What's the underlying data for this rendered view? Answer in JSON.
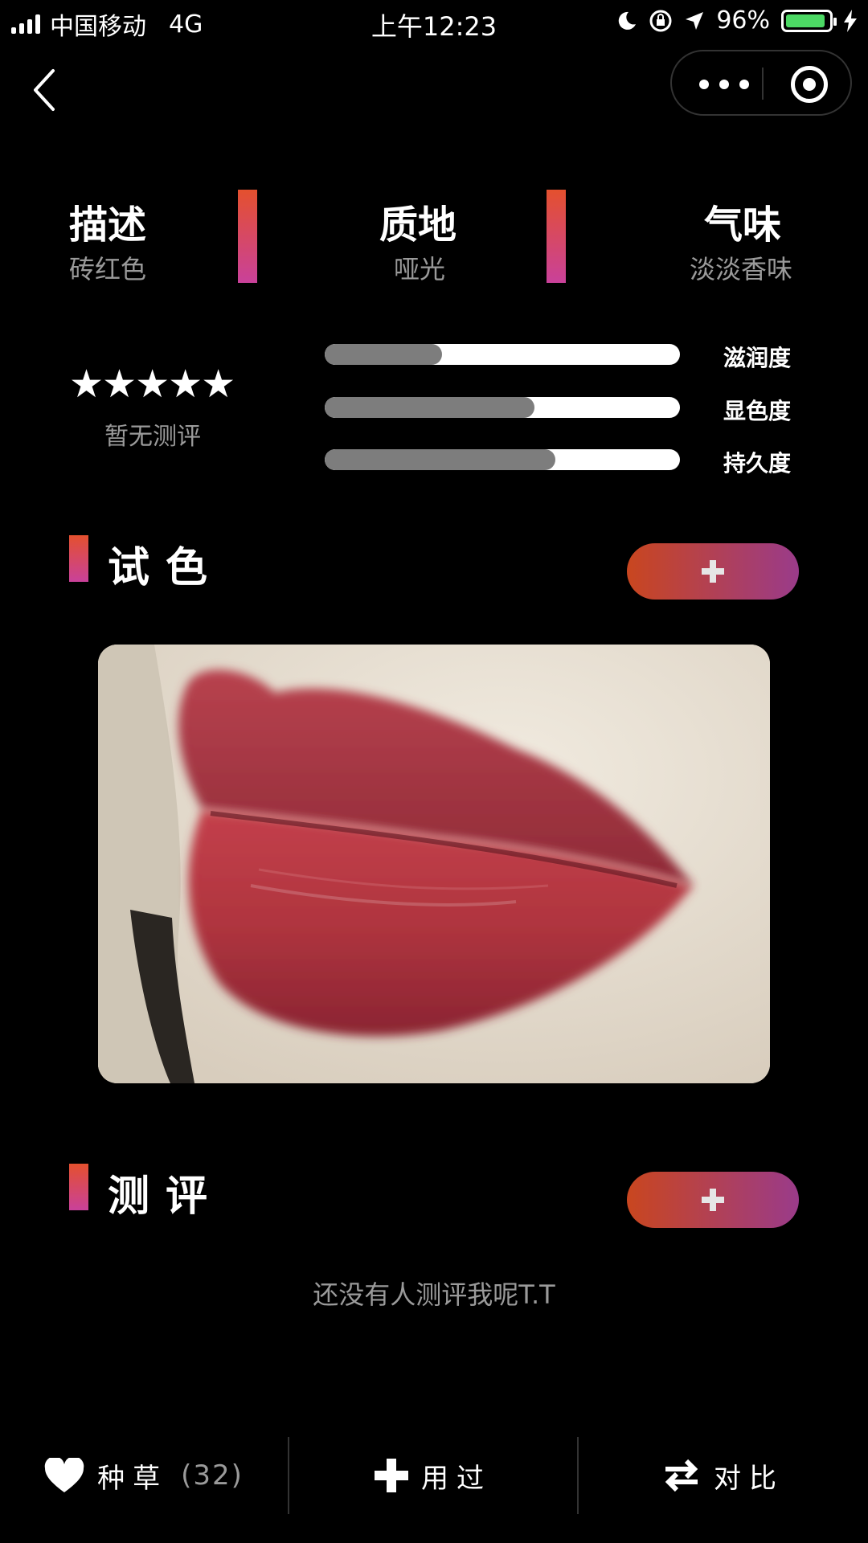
{
  "status_bar": {
    "carrier": "中国移动",
    "network": "4G",
    "time": "上午12:23",
    "battery_percent": "96%",
    "battery_color": "#4cd964"
  },
  "nav": {
    "back_icon": "chevron-left-icon",
    "more_icon": "more-dots-icon",
    "close_icon": "target-icon"
  },
  "attributes": [
    {
      "title": "描述",
      "value": "砖红色"
    },
    {
      "title": "质地",
      "value": "哑光"
    },
    {
      "title": "气味",
      "value": "淡淡香味"
    }
  ],
  "rating": {
    "stars": "★★★★★",
    "text": "暂无测评"
  },
  "metrics": [
    {
      "label": "滋润度",
      "level": 0.33
    },
    {
      "label": "显色度",
      "level": 0.59
    },
    {
      "label": "持久度",
      "level": 0.65
    }
  ],
  "swatch_section": {
    "title": "试色",
    "add_icon": "plus-icon"
  },
  "review_section": {
    "title": "测评",
    "empty_text": "还没有人测评我呢T.T",
    "add_icon": "plus-icon"
  },
  "bottom_bar": {
    "wishlist_label": "种草",
    "wishlist_count": "(32)",
    "used_label": "用过",
    "compare_label": "对比"
  },
  "colors": {
    "accent_start": "#e4502e",
    "accent_end": "#c9419a",
    "background": "#000000"
  }
}
